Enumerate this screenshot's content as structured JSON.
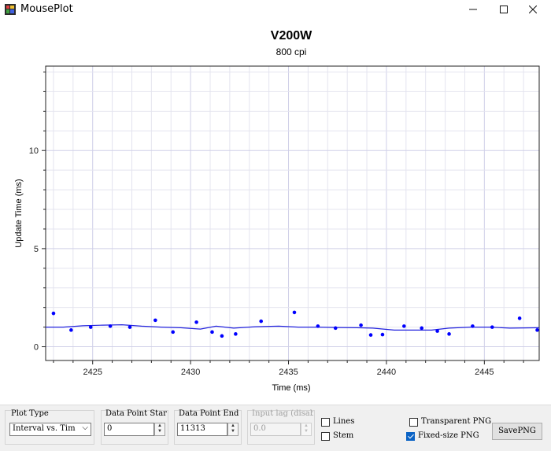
{
  "window": {
    "title": "MousePlot",
    "minimize_icon": "minimize-icon",
    "maximize_icon": "maximize-icon",
    "close_icon": "close-icon"
  },
  "chart_data": {
    "type": "scatter",
    "title": "V200W",
    "subtitle": "800 cpi",
    "xlabel": "Time (ms)",
    "ylabel": "Update Time (ms)",
    "xlim": [
      2422.6,
      2447.8
    ],
    "ylim": [
      -0.7,
      14.3
    ],
    "xticks": [
      2425,
      2430,
      2435,
      2440,
      2445
    ],
    "yticks": [
      0,
      5,
      10
    ],
    "grid": true,
    "points": [
      [
        2423.0,
        1.7
      ],
      [
        2423.9,
        0.85
      ],
      [
        2424.9,
        1.0
      ],
      [
        2425.9,
        1.05
      ],
      [
        2426.9,
        1.0
      ],
      [
        2428.2,
        1.35
      ],
      [
        2429.1,
        0.75
      ],
      [
        2430.3,
        1.25
      ],
      [
        2431.1,
        0.75
      ],
      [
        2431.6,
        0.55
      ],
      [
        2432.3,
        0.65
      ],
      [
        2433.6,
        1.3
      ],
      [
        2435.3,
        1.75
      ],
      [
        2436.5,
        1.05
      ],
      [
        2437.4,
        0.95
      ],
      [
        2438.7,
        1.1
      ],
      [
        2439.2,
        0.6
      ],
      [
        2439.8,
        0.62
      ],
      [
        2440.9,
        1.05
      ],
      [
        2441.8,
        0.95
      ],
      [
        2442.6,
        0.8
      ],
      [
        2443.2,
        0.65
      ],
      [
        2444.4,
        1.05
      ],
      [
        2445.4,
        1.0
      ],
      [
        2446.8,
        1.45
      ],
      [
        2447.7,
        0.85
      ]
    ],
    "trend": [
      [
        2422.6,
        1.0
      ],
      [
        2423.5,
        1.0
      ],
      [
        2424.5,
        1.07
      ],
      [
        2425.5,
        1.1
      ],
      [
        2426.5,
        1.12
      ],
      [
        2427.5,
        1.05
      ],
      [
        2428.5,
        1.0
      ],
      [
        2429.5,
        0.97
      ],
      [
        2430.5,
        0.9
      ],
      [
        2431.3,
        1.05
      ],
      [
        2432.2,
        0.95
      ],
      [
        2433.3,
        1.02
      ],
      [
        2434.5,
        1.05
      ],
      [
        2435.5,
        1.0
      ],
      [
        2436.5,
        1.0
      ],
      [
        2437.5,
        0.98
      ],
      [
        2438.5,
        0.97
      ],
      [
        2439.3,
        0.95
      ],
      [
        2440.4,
        0.85
      ],
      [
        2441.5,
        0.85
      ],
      [
        2442.3,
        0.85
      ],
      [
        2443.2,
        0.95
      ],
      [
        2444.3,
        1.0
      ],
      [
        2445.3,
        1.0
      ],
      [
        2446.3,
        0.95
      ],
      [
        2447.8,
        0.97
      ]
    ],
    "point_color": "#0000ff",
    "line_color": "#2222dd",
    "grid_color": "#e4e4ef",
    "major_grid_color": "#cfcfe8"
  },
  "controls": {
    "plot_type_label": "Plot Type",
    "plot_type_value": "Interval vs. Tim",
    "data_point_start_label": "Data Point Start",
    "data_point_start_value": "0",
    "data_point_end_label": "Data Point End",
    "data_point_end_value": "11313",
    "input_lag_label": "Input lag (disabled)",
    "input_lag_value": "0.0",
    "lines_label": "Lines",
    "stem_label": "Stem",
    "transparent_png_label": "Transparent PNG",
    "fixed_size_png_label": "Fixed-size PNG",
    "save_png_label": "SavePNG"
  }
}
